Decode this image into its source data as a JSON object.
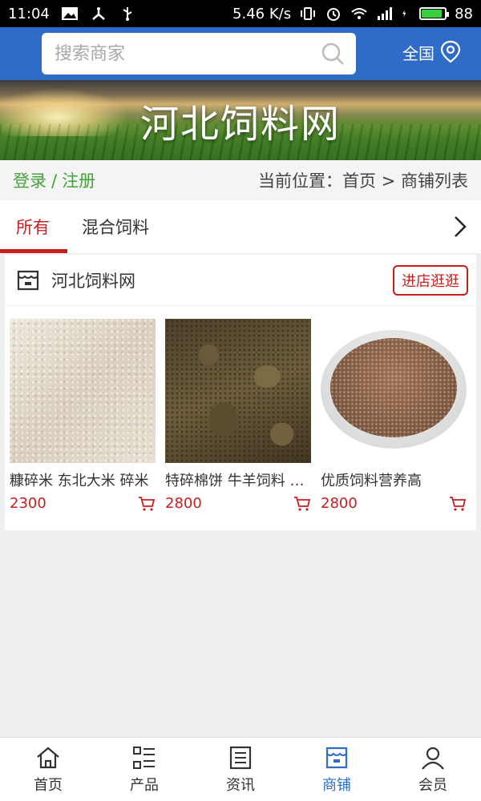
{
  "status_bar": {
    "time": "11:04",
    "speed": "5.46 K/s",
    "battery": "88",
    "battery_level": 0.88
  },
  "header": {
    "search_placeholder": "搜索商家",
    "region": "全国"
  },
  "banner": {
    "title": "河北饲料网"
  },
  "breadcrumb": {
    "login": "登录",
    "separator": "/",
    "register": "注册",
    "location": "当前位置：首页 > 商铺列表"
  },
  "tabs": [
    {
      "label": "所有",
      "active": true
    },
    {
      "label": "混合饲料",
      "active": false
    }
  ],
  "shop": {
    "name": "河北饲料网",
    "visit_label": "进店逛逛",
    "products": [
      {
        "name": "糠碎米 东北大米 碎米",
        "price": "2300"
      },
      {
        "name": "特碎棉饼 牛羊饲料 棉饼",
        "price": "2800"
      },
      {
        "name": "优质饲料营养高",
        "price": "2800"
      }
    ]
  },
  "bottom_nav": [
    {
      "label": "首页",
      "icon": "home-icon",
      "active": false
    },
    {
      "label": "产品",
      "icon": "product-list-icon",
      "active": false
    },
    {
      "label": "资讯",
      "icon": "news-icon",
      "active": false
    },
    {
      "label": "商铺",
      "icon": "shop-icon",
      "active": true
    },
    {
      "label": "会员",
      "icon": "user-icon",
      "active": false
    }
  ],
  "colors": {
    "header_blue": "#2f6cc7",
    "accent_red": "#c81e1e",
    "login_green": "#44a33b"
  }
}
